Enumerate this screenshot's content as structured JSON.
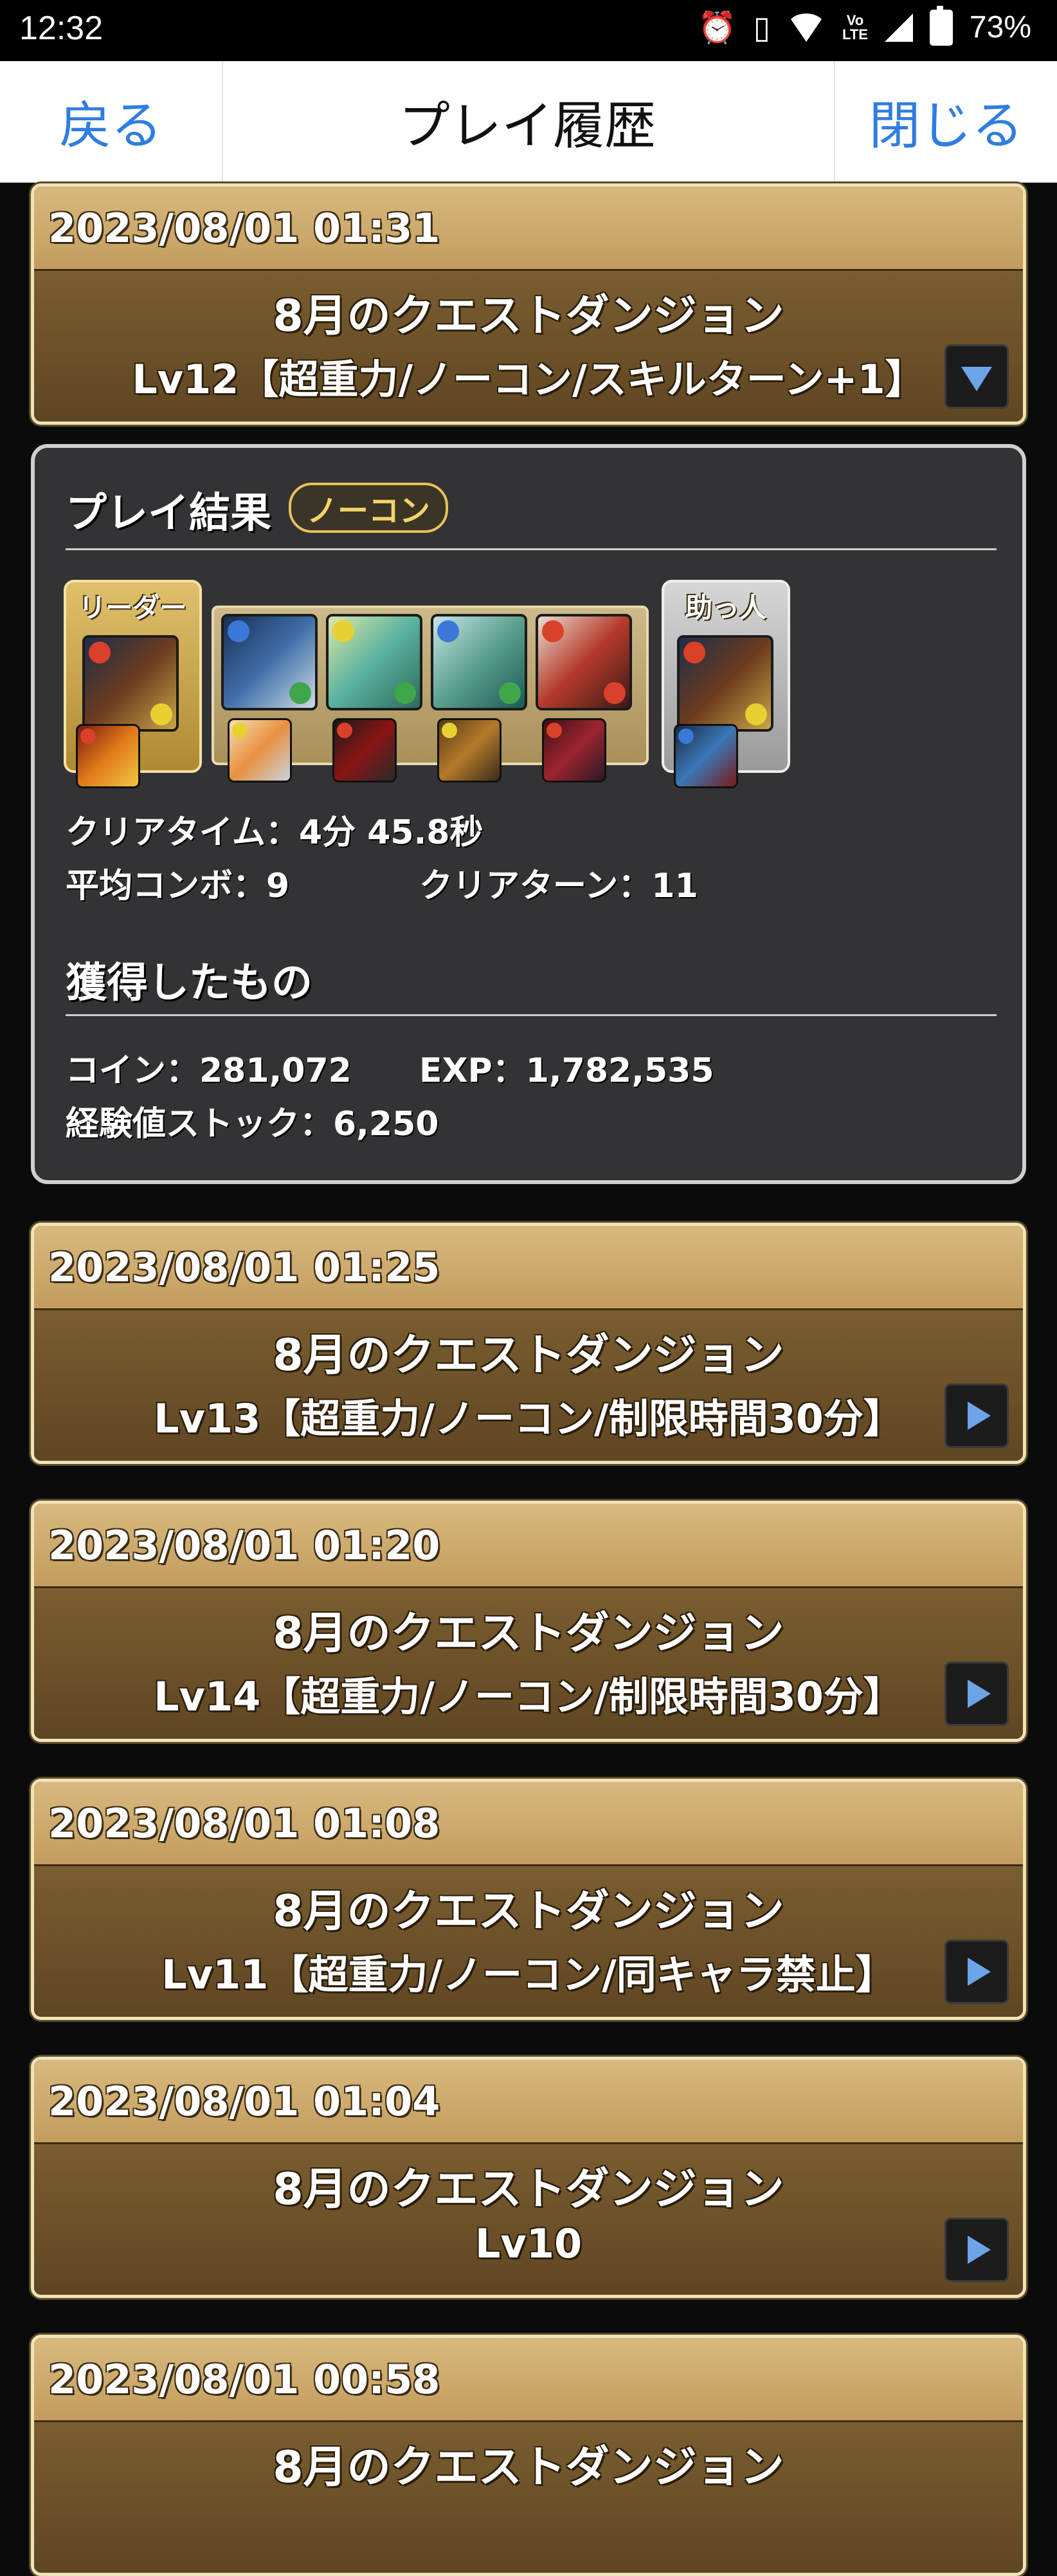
{
  "status_bar": {
    "time": "12:32",
    "battery": "73%",
    "icons": [
      "alarm-icon",
      "vibrate-icon",
      "wifi-icon",
      "volte-icon",
      "signal-icon",
      "battery-icon"
    ]
  },
  "nav": {
    "back": "戻る",
    "title": "プレイ履歴",
    "close": "閉じる"
  },
  "expanded_entry": {
    "date": "2023/08/01 01:31",
    "dungeon": "8月のクエストダンジョン",
    "level": "Lv12【超重力/ノーコン/スキルターン+1】"
  },
  "result": {
    "title": "プレイ結果",
    "badge": "ノーコン",
    "leader_label": "リーダー",
    "helper_label": "助っ人",
    "clear_time": "クリアタイム：4分 45.8秒",
    "avg_combo": "平均コンボ：9",
    "clear_turn": "クリアターン：11",
    "gained_title": "獲得したもの",
    "coin": "コイン：281,072",
    "exp": "EXP：1,782,535",
    "exp_stock": "経験値ストック：6,250"
  },
  "entries": [
    {
      "date": "2023/08/01 01:25",
      "dungeon": "8月のクエストダンジョン",
      "level": "Lv13【超重力/ノーコン/制限時間30分】"
    },
    {
      "date": "2023/08/01 01:20",
      "dungeon": "8月のクエストダンジョン",
      "level": "Lv14【超重力/ノーコン/制限時間30分】"
    },
    {
      "date": "2023/08/01 01:08",
      "dungeon": "8月のクエストダンジョン",
      "level": "Lv11【超重力/ノーコン/同キャラ禁止】"
    },
    {
      "date": "2023/08/01 01:04",
      "dungeon": "8月のクエストダンジョン",
      "level": "Lv10"
    },
    {
      "date": "2023/08/01 00:58",
      "dungeon": "8月のクエストダンジョン",
      "level": ""
    }
  ],
  "colors": {
    "nav_link": "#2f7de1",
    "card_header": "#c9a463",
    "card_body": "#6b5029",
    "panel_bg": "#333335",
    "badge_gold": "#e8c15a"
  }
}
